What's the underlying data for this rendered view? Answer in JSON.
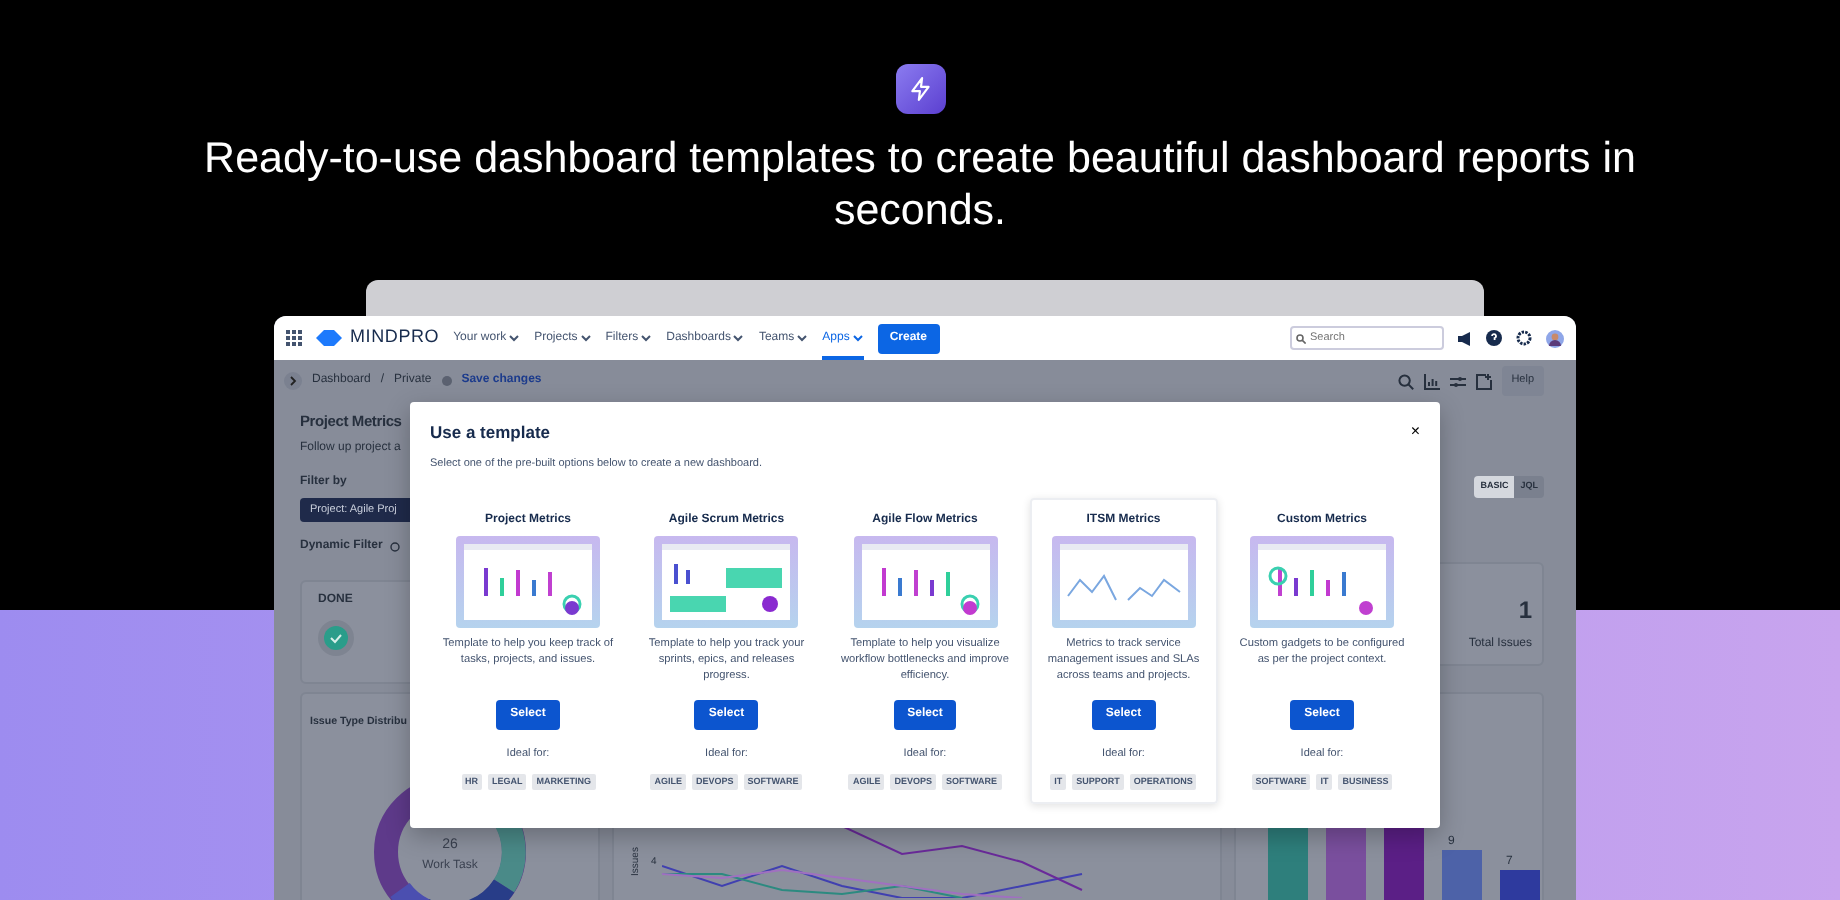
{
  "hero": {
    "headline": "Ready-to-use dashboard templates to create beautiful dashboard reports in seconds."
  },
  "nav": {
    "logo": "**MIND**PRO",
    "items": [
      {
        "label": "Your work",
        "selected": false
      },
      {
        "label": "Projects",
        "selected": false
      },
      {
        "label": "Filters",
        "selected": false
      },
      {
        "label": "Dashboards",
        "selected": false
      },
      {
        "label": "Teams",
        "selected": false
      },
      {
        "label": "Apps",
        "selected": true
      }
    ],
    "create": "Create",
    "search": {
      "placeholder": "Search"
    }
  },
  "toolbar": {
    "breadcrumbs": [
      "Dashboard",
      "Private"
    ],
    "separator": "/",
    "save": "Save changes",
    "help": "Help"
  },
  "dashboard": {
    "title": "Project Metrics",
    "subtitle": "Follow up project a",
    "filter_label": "Filter by",
    "filter_value": "Project: Agile Proj",
    "dynamic_filter": "Dynamic Filter",
    "query_modes": [
      {
        "label": "BASIC",
        "selected": true
      },
      {
        "label": "JQL",
        "selected": false
      }
    ],
    "done_label": "DONE",
    "total": {
      "value": "1",
      "label": "Total Issues"
    },
    "distribution": {
      "title": "Issue Type Distribu",
      "center_value": "26",
      "center_label": "Work Task"
    },
    "trend": {
      "axis_label": "Issues",
      "tick": "4"
    },
    "bars": {
      "labels": [
        "9",
        "7"
      ]
    }
  },
  "modal": {
    "title": "Use a template",
    "subtitle": "Select one of the pre-built options below to create a new dashboard.",
    "close": "×",
    "templates": [
      {
        "title": "Project Metrics",
        "description": "Template to help you keep track of tasks, projects, and issues.",
        "button": "Select",
        "ideal_label": "Ideal for:",
        "tags": [
          "HR",
          "LEGAL",
          "MARKETING"
        ],
        "selected": false
      },
      {
        "title": "Agile Scrum Metrics",
        "description": "Template to help you track your sprints, epics, and releases progress.",
        "button": "Select",
        "ideal_label": "Ideal for:",
        "tags": [
          "AGILE",
          "DEVOPS",
          "SOFTWARE"
        ],
        "selected": false
      },
      {
        "title": "Agile Flow Metrics",
        "description": "Template to help you visualize workflow bottlenecks and improve efficiency.",
        "button": "Select",
        "ideal_label": "Ideal for:",
        "tags": [
          "AGILE",
          "DEVOPS",
          "SOFTWARE"
        ],
        "selected": false
      },
      {
        "title": "ITSM Metrics",
        "description": "Metrics to track service management issues and SLAs across teams and projects.",
        "button": "Select",
        "ideal_label": "Ideal for:",
        "tags": [
          "IT",
          "SUPPORT",
          "OPERATIONS"
        ],
        "selected": true
      },
      {
        "title": "Custom Metrics",
        "description": "Custom gadgets to be configured as per the project context.",
        "button": "Select",
        "ideal_label": "Ideal for:",
        "tags": [
          "SOFTWARE",
          "IT",
          "BUSINESS"
        ],
        "selected": false
      }
    ]
  }
}
